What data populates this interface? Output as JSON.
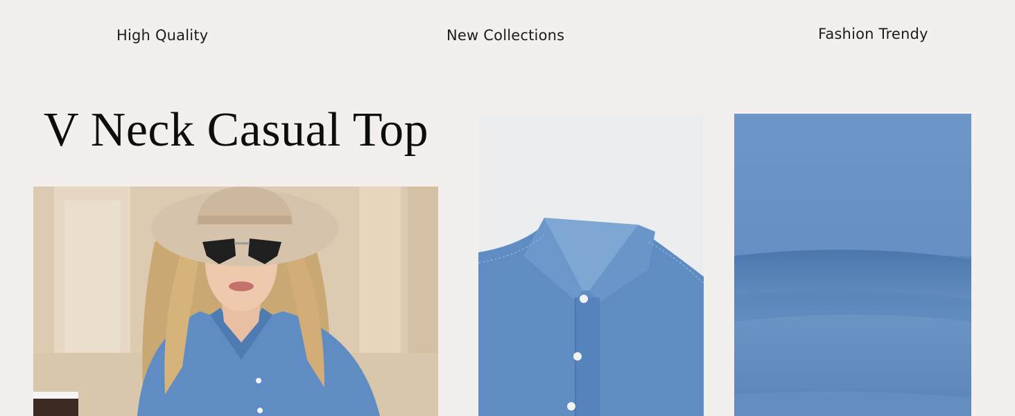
{
  "features": {
    "quality": "High Quality",
    "collections": "New Collections",
    "trendy": "Fashion Trendy"
  },
  "product": {
    "title": "V Neck Casual Top"
  },
  "colors": {
    "background": "#f2efec",
    "denim": "#5f8cc3",
    "hat": "#d6c3ab"
  },
  "images": [
    {
      "name": "model-photo",
      "description_icon": "woman-in-denim-shirt"
    },
    {
      "name": "collar-closeup",
      "description_icon": "denim-collar"
    },
    {
      "name": "fabric-texture",
      "description_icon": "denim-fabric"
    }
  ]
}
